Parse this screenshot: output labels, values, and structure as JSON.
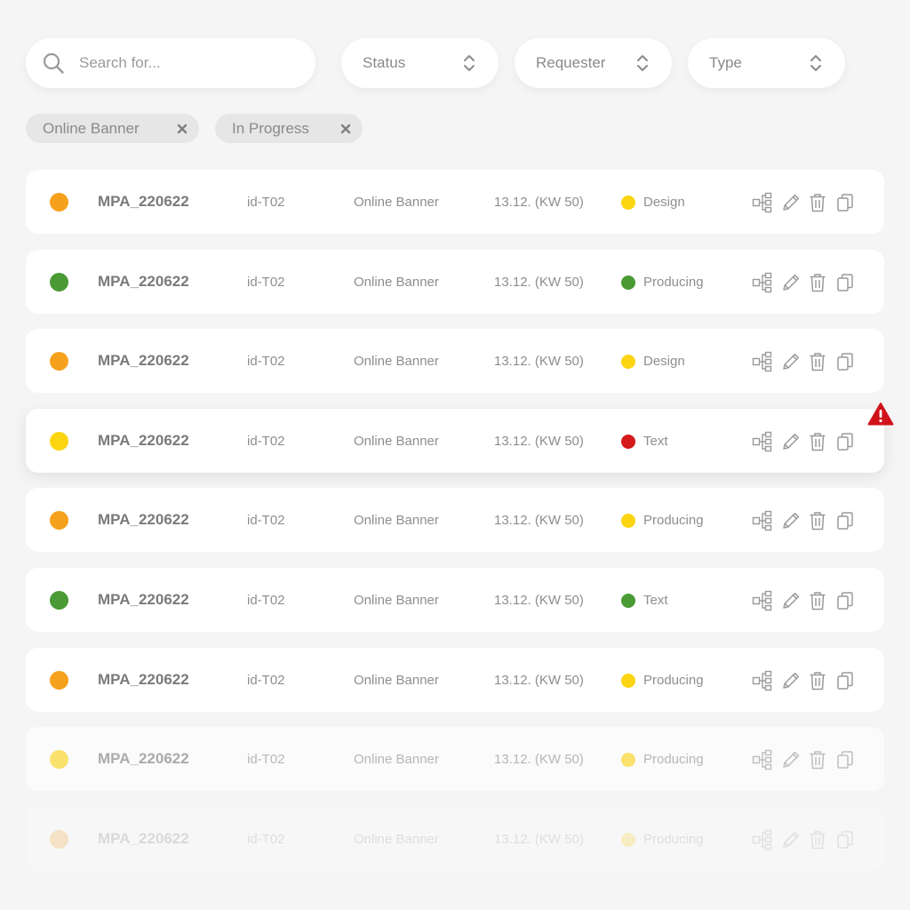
{
  "search": {
    "placeholder": "Search for..."
  },
  "filters": [
    {
      "label": "Status"
    },
    {
      "label": "Requester"
    },
    {
      "label": "Type"
    }
  ],
  "chips": [
    {
      "label": "Online Banner"
    },
    {
      "label": "In Progress"
    }
  ],
  "colors": {
    "orange": "#f6a11c",
    "green": "#4a9a35",
    "yellow": "#fcd512",
    "red": "#d41a1a",
    "warning": "#d0131a"
  },
  "rows": [
    {
      "job": "MPA_220622",
      "id": "id-T02",
      "type": "Online Banner",
      "date": "13.12. (KW 50)",
      "priority_color": "#f6a11c",
      "status": "Design",
      "status_color": "#fcd512",
      "opacity": 1
    },
    {
      "job": "MPA_220622",
      "id": "id-T02",
      "type": "Online Banner",
      "date": "13.12. (KW 50)",
      "priority_color": "#4a9a35",
      "status": "Producing",
      "status_color": "#4a9a35",
      "opacity": 1
    },
    {
      "job": "MPA_220622",
      "id": "id-T02",
      "type": "Online Banner",
      "date": "13.12. (KW 50)",
      "priority_color": "#f6a11c",
      "status": "Design",
      "status_color": "#fcd512",
      "opacity": 1
    },
    {
      "job": "MPA_220622",
      "id": "id-T02",
      "type": "Online Banner",
      "date": "13.12. (KW 50)",
      "priority_color": "#fcd512",
      "status": "Text",
      "status_color": "#d41a1a",
      "opacity": 1,
      "elevated": true,
      "warning": true
    },
    {
      "job": "MPA_220622",
      "id": "id-T02",
      "type": "Online Banner",
      "date": "13.12. (KW 50)",
      "priority_color": "#f6a11c",
      "status": "Producing",
      "status_color": "#fcd512",
      "opacity": 1
    },
    {
      "job": "MPA_220622",
      "id": "id-T02",
      "type": "Online Banner",
      "date": "13.12. (KW 50)",
      "priority_color": "#4a9a35",
      "status": "Text",
      "status_color": "#4a9a35",
      "opacity": 1
    },
    {
      "job": "MPA_220622",
      "id": "id-T02",
      "type": "Online Banner",
      "date": "13.12. (KW 50)",
      "priority_color": "#f6a11c",
      "status": "Producing",
      "status_color": "#fcd512",
      "opacity": 1
    },
    {
      "job": "MPA_220622",
      "id": "id-T02",
      "type": "Online Banner",
      "date": "13.12. (KW 50)",
      "priority_color": "#fcd512",
      "status": "Producing",
      "status_color": "#fcd512",
      "opacity": 0.6
    },
    {
      "job": "MPA_220622",
      "id": "id-T02",
      "type": "Online Banner",
      "date": "13.12. (KW 50)",
      "priority_color": "#f6a11c",
      "status": "Producing",
      "status_color": "#fcd512",
      "opacity": 0.22
    }
  ],
  "icons": {
    "search": "search-icon",
    "sort": "sort-arrows-icon",
    "remove": "close-icon",
    "actions": [
      "hierarchy-icon",
      "pencil-icon",
      "trash-icon",
      "copy-icon"
    ],
    "warning": "warning-icon"
  }
}
